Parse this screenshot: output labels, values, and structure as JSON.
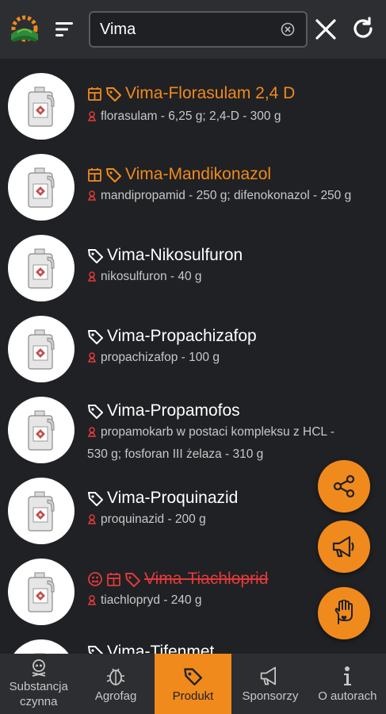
{
  "header": {
    "search_value": "Vima"
  },
  "items": [
    {
      "title": "Vima-Florasulam 2,4 D",
      "substance": "florasulam - 6,25 g; 2,4-D - 300 g",
      "style": "orange"
    },
    {
      "title": "Vima-Mandikonazol",
      "substance": "mandipropamid - 250 g; difenokonazol - 250 g",
      "style": "orange"
    },
    {
      "title": "Vima-Nikosulfuron",
      "substance": "nikosulfuron - 40 g",
      "style": "white"
    },
    {
      "title": "Vima-Propachizafop",
      "substance": "propachizafop - 100 g",
      "style": "white"
    },
    {
      "title": "Vima-Propamofos",
      "substance_line1": "propamokarb w postaci kompleksu z HCL -",
      "substance_line2": "530 g; fosforan III żelaza - 310 g",
      "style": "white"
    },
    {
      "title": "Vima-Proquinazid",
      "substance": "proquinazid - 200 g",
      "style": "white"
    },
    {
      "title": "Vima-Tiachloprid",
      "substance": "tiachlopryd - 240 g",
      "style": "red"
    },
    {
      "title": "Vima-Tifenmet",
      "style": "white"
    }
  ],
  "fabs": {
    "share": "share-icon",
    "sponsor": "megaphone-icon",
    "support": "hand-heart-icon"
  },
  "tabs": [
    {
      "label_line1": "Substancja",
      "label_line2": "czynna"
    },
    {
      "label_line1": "Agrofag"
    },
    {
      "label_line1": "Produkt"
    },
    {
      "label_line1": "Sponsorzy"
    },
    {
      "label_line1": "O autorach"
    }
  ],
  "colors": {
    "accent": "#f08a1c",
    "withdrawn": "#e03a3a",
    "background": "#202124",
    "bar": "#2d2e31"
  }
}
